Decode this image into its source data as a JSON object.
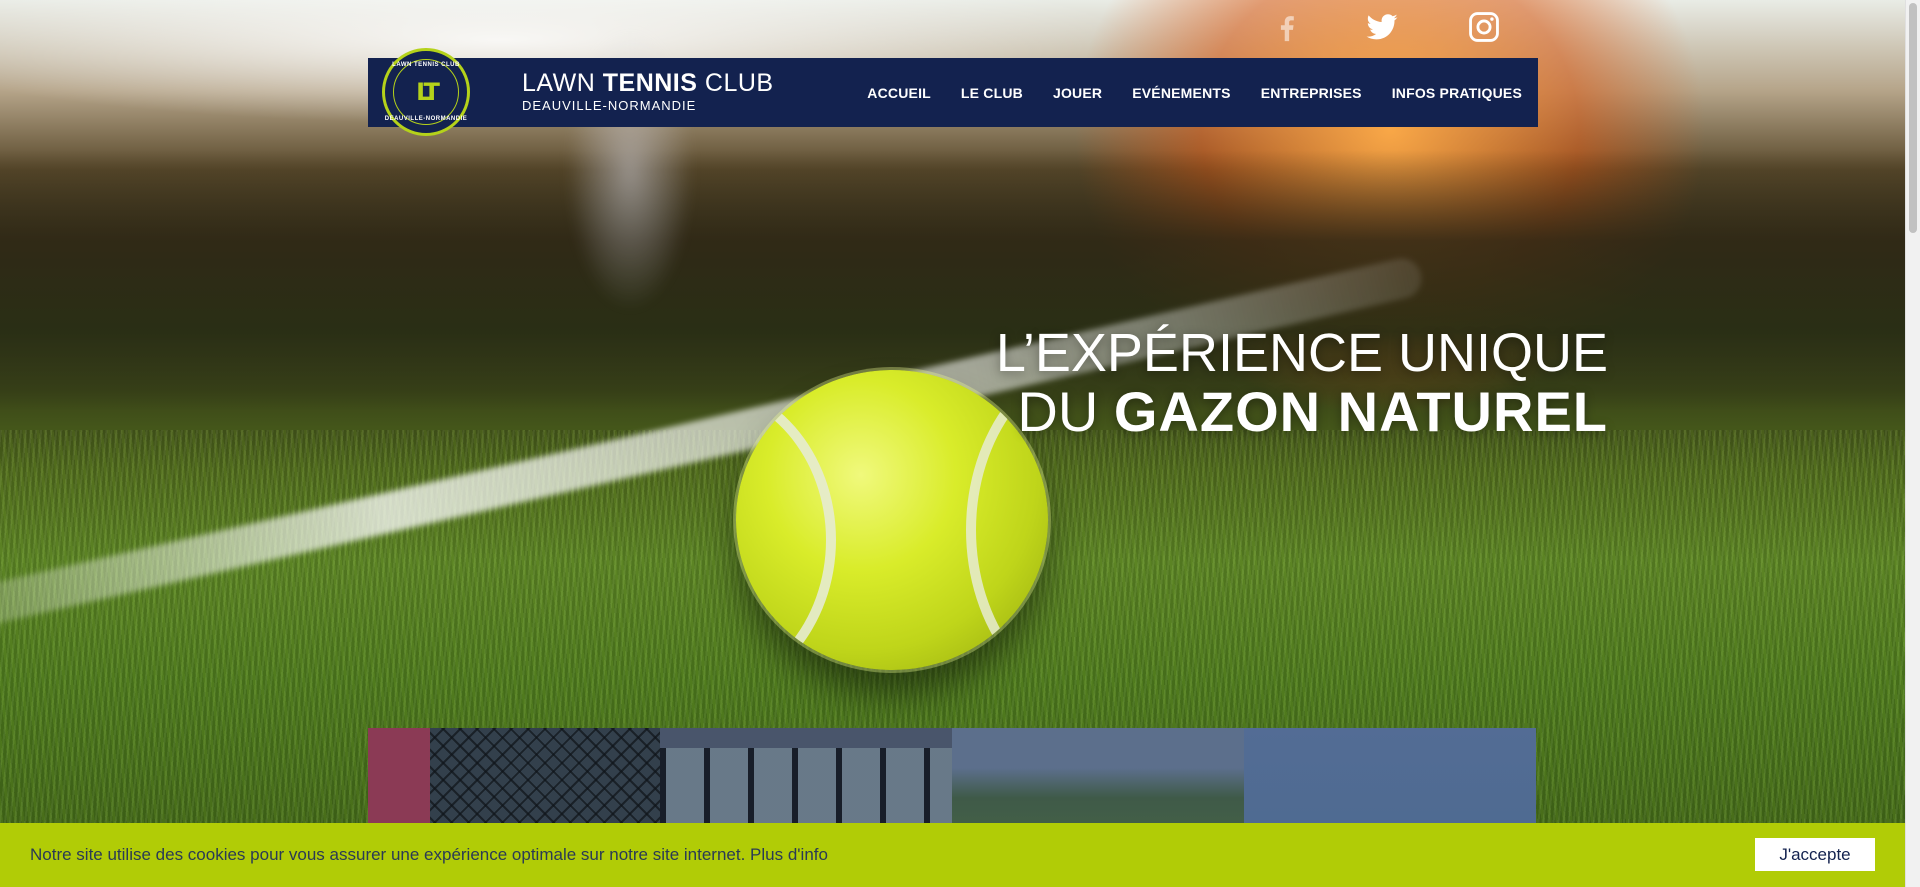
{
  "social": {
    "facebook": "facebook-icon",
    "twitter": "twitter-icon",
    "instagram": "instagram-icon"
  },
  "header": {
    "logo": {
      "monogram": "LT",
      "ring_top": "LAWN TENNIS CLUB",
      "ring_bottom": "DEAUVILLE-NORMANDIE"
    },
    "brand_prefix": "LAWN ",
    "brand_bold": "TENNIS",
    "brand_suffix": " CLUB",
    "brand_sub": "DEAUVILLE-NORMANDIE",
    "nav": [
      "ACCUEIL",
      "LE CLUB",
      "JOUER",
      "EVÉNEMENTS",
      "ENTREPRISES",
      "INFOS PRATIQUES"
    ]
  },
  "hero": {
    "line1": "L’EXPÉRIENCE UNIQUE",
    "line2_thin": "DU ",
    "line2_bold": "GAZON NATUREL"
  },
  "cookie": {
    "text": "Notre site utilise des cookies pour vous assurer une expérience optimale sur notre site internet. ",
    "link": "Plus d'info",
    "button": "J'accepte"
  },
  "colors": {
    "navy": "#13224f",
    "lime": "#b1cc06"
  }
}
